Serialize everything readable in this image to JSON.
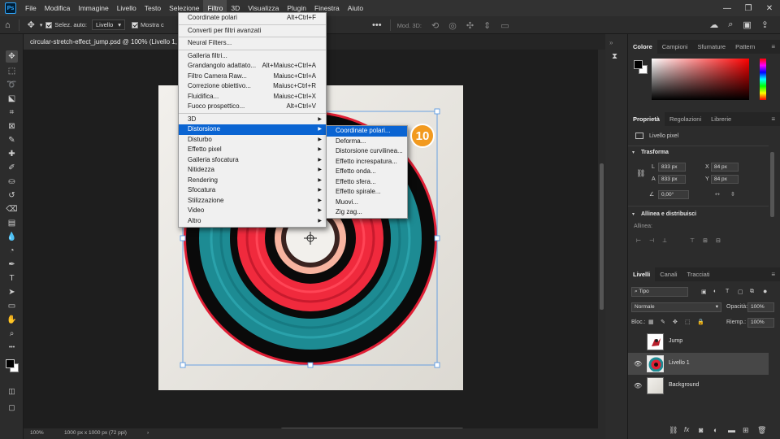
{
  "menubar": {
    "items": [
      "File",
      "Modifica",
      "Immagine",
      "Livello",
      "Testo",
      "Selezione",
      "Filtro",
      "3D",
      "Visualizza",
      "Plugin",
      "Finestra",
      "Aiuto"
    ],
    "active_index": 6,
    "logo": "Ps"
  },
  "options_bar": {
    "auto_select_label": "Selez. auto:",
    "auto_select_value": "Livello",
    "show_label": "Mostra c",
    "mode_3d_label": "Mod. 3D:"
  },
  "document": {
    "tab_title": "circular-stretch-effect_jump.psd @ 100% (Livello 1, RG",
    "zoom": "100%",
    "doc_info": "1000 px x 1000 px (72 ppi)"
  },
  "filter_menu": {
    "last_filter": {
      "label": "Coordinate polari",
      "shortcut": "Alt+Ctrl+F"
    },
    "smart_filters": "Converti per filtri avanzati",
    "neural": "Neural Filters...",
    "group1": [
      {
        "label": "Galleria filtri...",
        "shortcut": ""
      },
      {
        "label": "Grandangolo adattato...",
        "shortcut": "Alt+Maiusc+Ctrl+A"
      },
      {
        "label": "Filtro Camera Raw...",
        "shortcut": "Maiusc+Ctrl+A"
      },
      {
        "label": "Correzione obiettivo...",
        "shortcut": "Maiusc+Ctrl+R"
      },
      {
        "label": "Fluidifica...",
        "shortcut": "Maiusc+Ctrl+X"
      },
      {
        "label": "Fuoco prospettico...",
        "shortcut": "Alt+Ctrl+V"
      }
    ],
    "submenus": [
      "3D",
      "Distorsione",
      "Disturbo",
      "Effetto pixel",
      "Galleria sfocatura",
      "Nitidezza",
      "Rendering",
      "Sfocatura",
      "Stilizzazione",
      "Video",
      "Altro"
    ],
    "highlighted_submenu": "Distorsione"
  },
  "distort_submenu": {
    "items": [
      "Coordinate polari...",
      "Deforma...",
      "Distorsione curvilinea...",
      "Effetto increspatura...",
      "Effetto onda...",
      "Effetto sfera...",
      "Effetto spirale...",
      "Muovi...",
      "Zig zag..."
    ],
    "highlighted": "Coordinate polari..."
  },
  "step_badge": {
    "number": "10",
    "color": "#f29a1f"
  },
  "color_panel": {
    "tabs": [
      "Colore",
      "Campioni",
      "Sfumature",
      "Pattern"
    ],
    "hue_color": "#ff0000"
  },
  "properties_panel": {
    "tabs": [
      "Proprietà",
      "Regolazioni",
      "Librerie"
    ],
    "layer_type": "Livello pixel",
    "transform_title": "Trasforma",
    "w_label": "L",
    "w_value": "833 px",
    "h_label": "A",
    "h_value": "833 px",
    "x_label": "X",
    "x_value": "84 px",
    "y_label": "Y",
    "y_value": "84 px",
    "angle_value": "0,00°",
    "align_title": "Allinea e distribuisci",
    "align_label": "Allinea:"
  },
  "layers_panel": {
    "tabs": [
      "Livelli",
      "Canali",
      "Tracciati"
    ],
    "filter_kind": "Tipo",
    "blend_mode": "Normale",
    "opacity_label": "Opacità:",
    "opacity_value": "100%",
    "lock_label": "Bloc.:",
    "fill_label": "Riemp.:",
    "fill_value": "100%",
    "layers": [
      {
        "name": "Jump",
        "visible": false,
        "selected": false
      },
      {
        "name": "Livello 1",
        "visible": true,
        "selected": true
      },
      {
        "name": "Background",
        "visible": true,
        "selected": false
      }
    ],
    "footer_icons": [
      "link-icon",
      "fx-icon",
      "mask-icon",
      "adjustment-icon",
      "group-icon",
      "new-layer-icon",
      "trash-icon"
    ]
  }
}
